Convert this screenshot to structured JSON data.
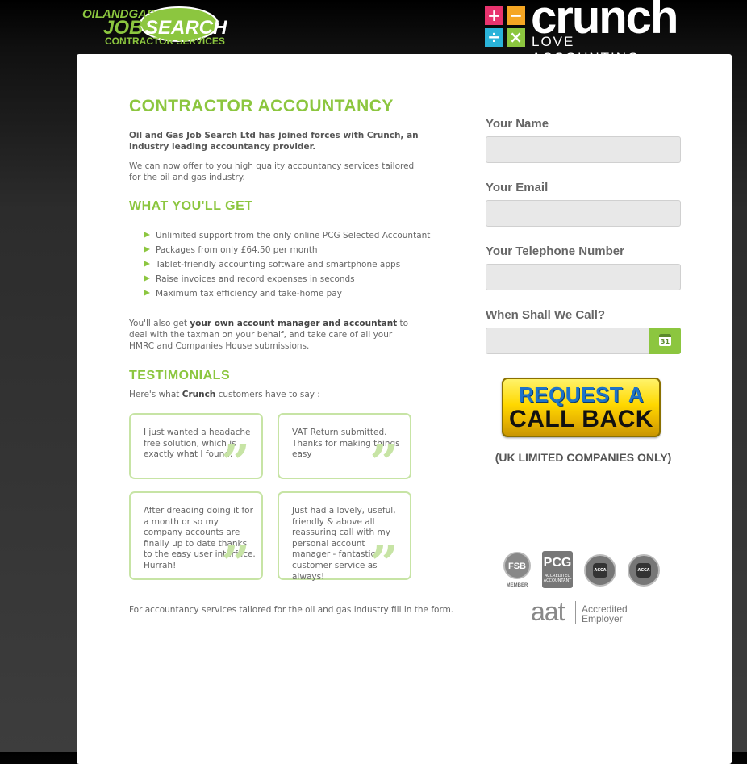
{
  "header": {
    "left_logo": {
      "line1": "OILANDGAS",
      "line2": "JOB",
      "line3": "SEARCH",
      "line4": "CONTRACTOR SERVICES"
    },
    "right_logo": {
      "symbols": [
        "+",
        "−",
        "÷",
        "×"
      ],
      "name": "crunch",
      "tagline": "LOVE ACCOUNTING",
      "colors": [
        "#e8336e",
        "#f5a623",
        "#2ab3d9",
        "#8cc63f"
      ]
    }
  },
  "content": {
    "title": "CONTRACTOR ACCOUNTANCY",
    "intro_strong": "Oil and Gas Job Search Ltd has joined forces with Crunch, an industry leading accountancy provider.",
    "intro": "We can now offer to you high quality accountancy services tailored for the oil and gas industry.",
    "benefits_heading": "WHAT YOU'LL GET",
    "benefits": [
      "Unlimited support from the only online PCG Selected Accountant",
      "Packages from only £64.50 per month",
      "Tablet-friendly accounting software and smartphone apps",
      "Raise invoices and record expenses in seconds",
      "Maximum tax efficiency and take-home pay"
    ],
    "also_prefix": "You'll also get ",
    "also_bold": "your own account manager and accountant",
    "also_suffix": " to deal with the taxman on your behalf, and take care of all your HMRC and Companies House submissions.",
    "testimonials_heading": "TESTIMONIALS",
    "say_prefix": "Here's what ",
    "say_bold": "Crunch",
    "say_suffix": " customers have to say :",
    "testimonials": [
      "I just wanted a headache free solution, which is exactly what I found.",
      "VAT Return submitted. Thanks for making things easy",
      "After dreading doing it for a month or so my company accounts are finally up to date thanks to the easy user interface. Hurrah!",
      "Just had a lovely, useful, friendly & above all reassuring call with my personal account manager - fantastic customer service as always!"
    ],
    "quote_mark": "”",
    "footer_note": "For accountancy services tailored for the oil and gas industry fill in the form."
  },
  "form": {
    "name_label": "Your Name",
    "name_value": "",
    "email_label": "Your Email",
    "email_value": "",
    "phone_label": "Your Telephone Number",
    "phone_value": "",
    "call_label": "When Shall We Call?",
    "call_value": "",
    "calendar_day": "31",
    "cta_line1": "REQUEST A",
    "cta_line2": "CALL BACK",
    "note": "(UK LIMITED COMPANIES ONLY)"
  },
  "badges": {
    "fsb": "FSB",
    "fsb_sub": "MEMBER",
    "pcg": "PCG",
    "pcg_sub": "ACCREDITED ACCOUNTANT",
    "acca1": "ACCA",
    "acca2": "ACCA",
    "aat": "aat",
    "aat_text1": "Accredited",
    "aat_text2": "Employer"
  }
}
